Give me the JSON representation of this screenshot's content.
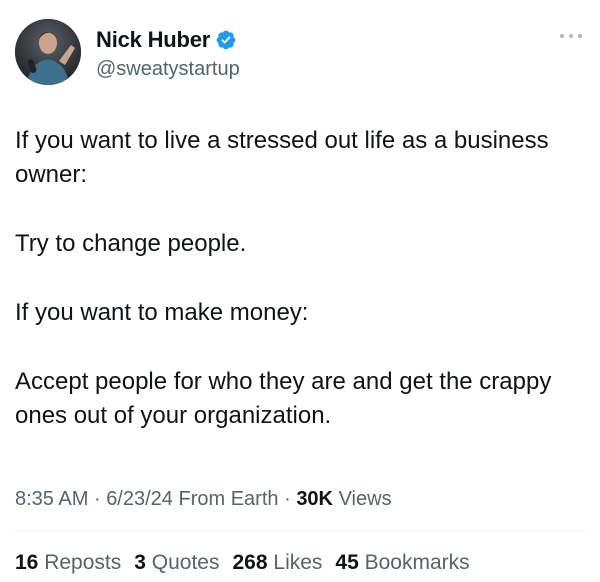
{
  "author": {
    "display_name": "Nick Huber",
    "handle": "@sweatystartup",
    "verified": true,
    "avatar_icon": "profile-photo"
  },
  "body": {
    "paragraphs": [
      "If you want to live a stressed out life as a business owner:",
      "Try to change people.",
      "If you want to make money:",
      "Accept people for who they are and get the crappy ones out of your organization."
    ]
  },
  "meta": {
    "time": "8:35 AM",
    "separator": "·",
    "date": "6/23/24",
    "source": "From Earth",
    "views_count": "30K",
    "views_label": "Views"
  },
  "stats": {
    "reposts_count": "16",
    "reposts_label": "Reposts",
    "quotes_count": "3",
    "quotes_label": "Quotes",
    "likes_count": "268",
    "likes_label": "Likes",
    "bookmarks_count": "45",
    "bookmarks_label": "Bookmarks"
  },
  "colors": {
    "text_primary": "#0f1419",
    "text_secondary": "#536471",
    "verified_blue": "#1d9bf0",
    "divider": "#eff3f4"
  }
}
